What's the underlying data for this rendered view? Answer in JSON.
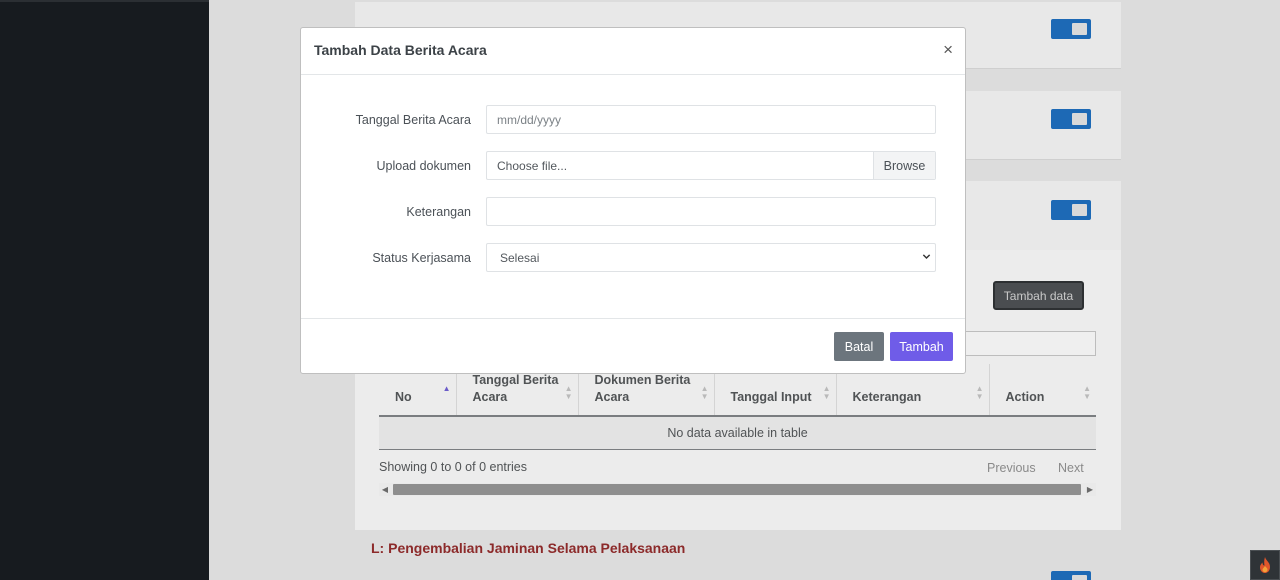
{
  "modal": {
    "title": "Tambah Data Berita Acara",
    "close_glyph": "×",
    "fields": {
      "date": {
        "label": "Tanggal Berita Acara",
        "placeholder": "mm/dd/yyyy"
      },
      "file": {
        "label": "Upload dokumen",
        "placeholder": "Choose file...",
        "browse_label": "Browse"
      },
      "note": {
        "label": "Keterangan",
        "value": ""
      },
      "status": {
        "label": "Status Kerjasama",
        "selected": "Selesai"
      }
    },
    "buttons": {
      "cancel": "Batal",
      "submit": "Tambah"
    }
  },
  "background": {
    "add_button": "Tambah data",
    "table": {
      "headers": [
        "No",
        "Tanggal Berita Acara",
        "Dokumen Berita Acara",
        "Tanggal Input",
        "Keterangan",
        "Action"
      ],
      "empty_message": "No data available in table"
    },
    "info": "Showing 0 to 0 of 0 entries",
    "pagination": {
      "previous": "Previous",
      "next": "Next"
    },
    "section_heading": "L: Pengembalian Jaminan Selama Pelaksanaan"
  },
  "colors": {
    "primary": "#6f5ce8",
    "secondary": "#6c757d",
    "toggle": "#1d69b5",
    "section_heading": "#8c2a2a"
  },
  "icons": [
    "close-icon",
    "chevron-down-icon",
    "sort-icon",
    "scroll-left-icon",
    "scroll-right-icon",
    "flame-icon"
  ]
}
